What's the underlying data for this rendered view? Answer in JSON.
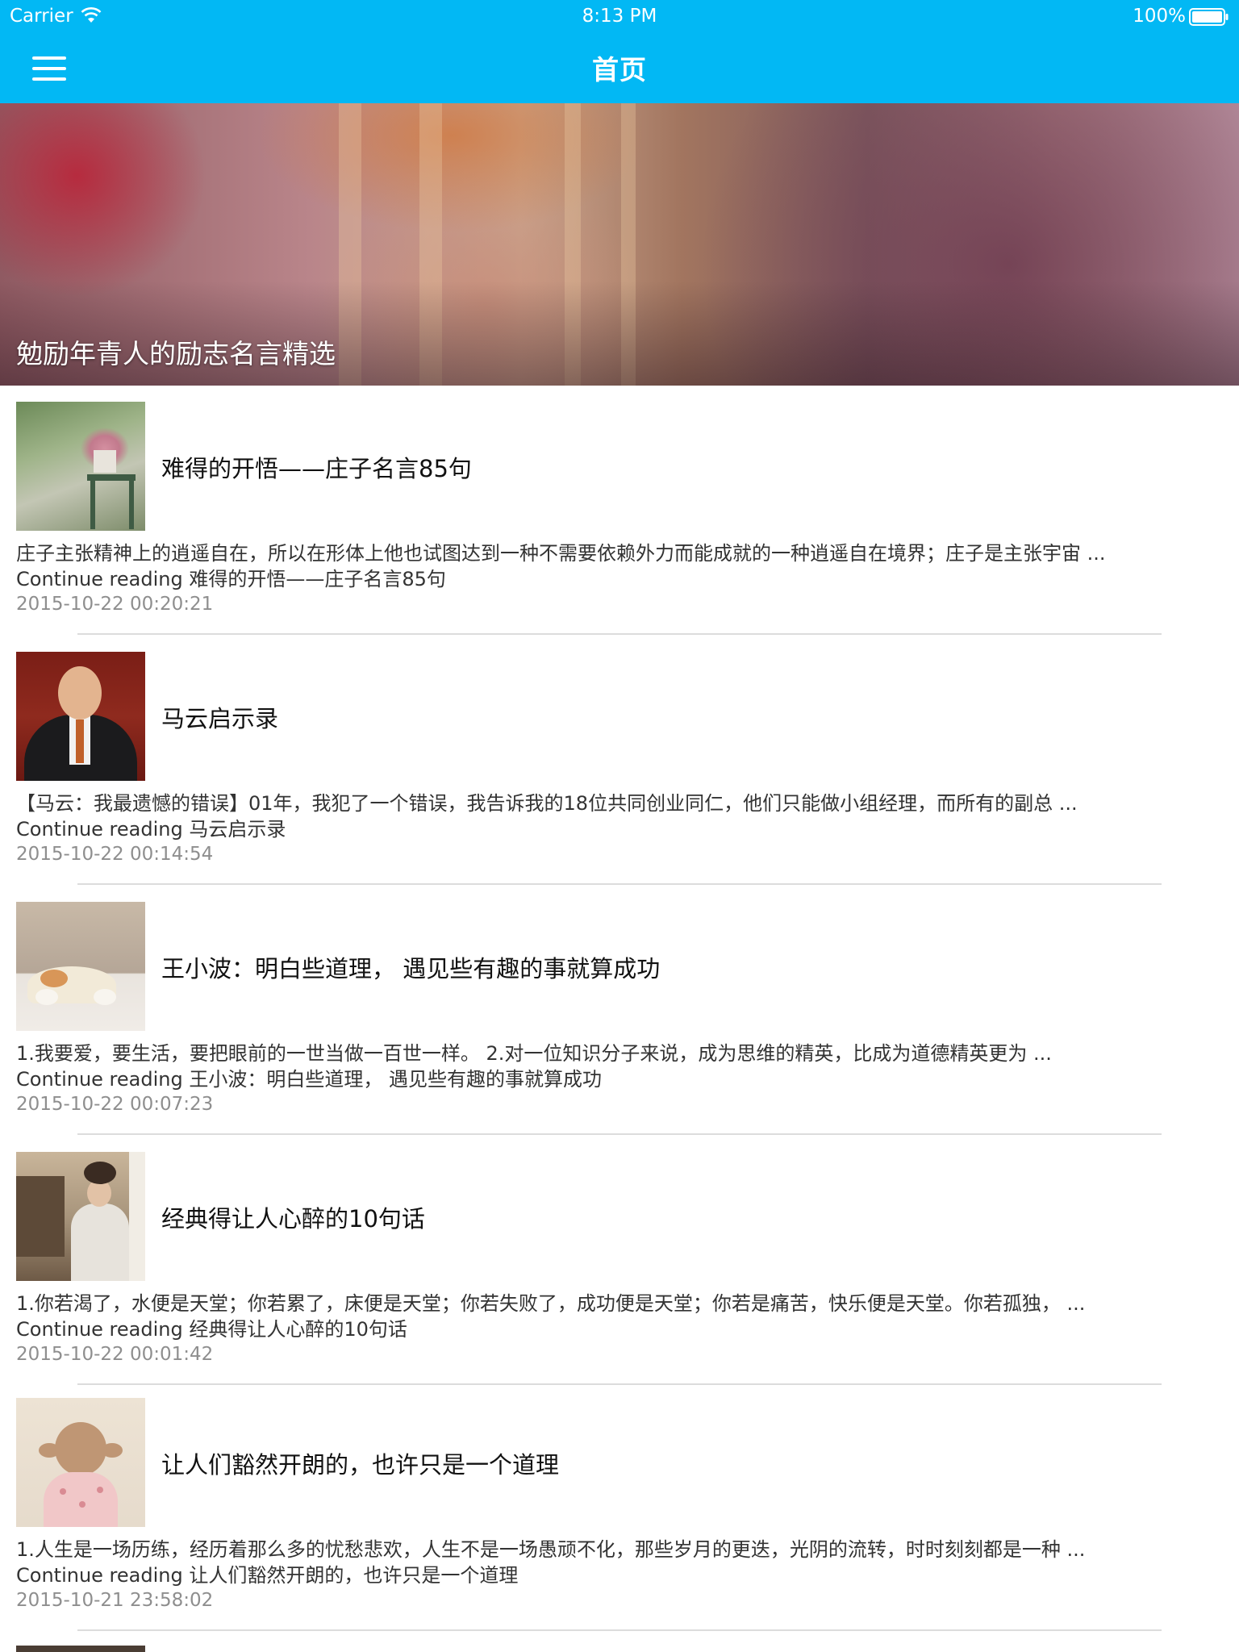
{
  "status_bar": {
    "carrier": "Carrier",
    "time": "8:13 PM",
    "battery": "100%"
  },
  "nav": {
    "title": "首页",
    "menu_icon": "hamburger-menu-icon",
    "color": "#02b8f4"
  },
  "hero": {
    "title": "勉励年青人的励志名言精选"
  },
  "articles": [
    {
      "title": "难得的开悟——庄子名言85句",
      "excerpt": "庄子主张精神上的逍遥自在，所以在形体上他也试图达到一种不需要依赖外力而能成就的一种逍遥自在境界；庄子是主张宇宙 ...",
      "continue": "Continue reading 难得的开悟——庄子名言85句",
      "date": "2015-10-22 00:20:21"
    },
    {
      "title": "马云启示录",
      "excerpt": "【马云：我最遗憾的错误】01年，我犯了一个错误，我告诉我的18位共同创业同仁，他们只能做小组经理，而所有的副总 ...",
      "continue": "Continue reading 马云启示录",
      "date": "2015-10-22 00:14:54"
    },
    {
      "title": "王小波：明白些道理， 遇见些有趣的事就算成功",
      "excerpt": "1.我要爱，要生活，要把眼前的一世当做一百世一样。 2.对一位知识分子来说，成为思维的精英，比成为道德精英更为 ...",
      "continue": "Continue reading 王小波：明白些道理， 遇见些有趣的事就算成功",
      "date": "2015-10-22 00:07:23"
    },
    {
      "title": "经典得让人心醉的10句话",
      "excerpt": "1.你若渴了，水便是天堂；你若累了，床便是天堂；你若失败了，成功便是天堂；你若是痛苦，快乐便是天堂。你若孤独，  ...",
      "continue": "Continue reading 经典得让人心醉的10句话",
      "date": "2015-10-22 00:01:42"
    },
    {
      "title": "让人们豁然开朗的，也许只是一个道理",
      "excerpt": "1.人生是一场历练，经历着那么多的忧愁悲欢，人生不是一场愚顽不化，那些岁月的更迭，光阴的流转，时时刻刻都是一种 ...",
      "continue": "Continue reading 让人们豁然开朗的，也许只是一个道理",
      "date": "2015-10-21 23:58:02"
    }
  ]
}
